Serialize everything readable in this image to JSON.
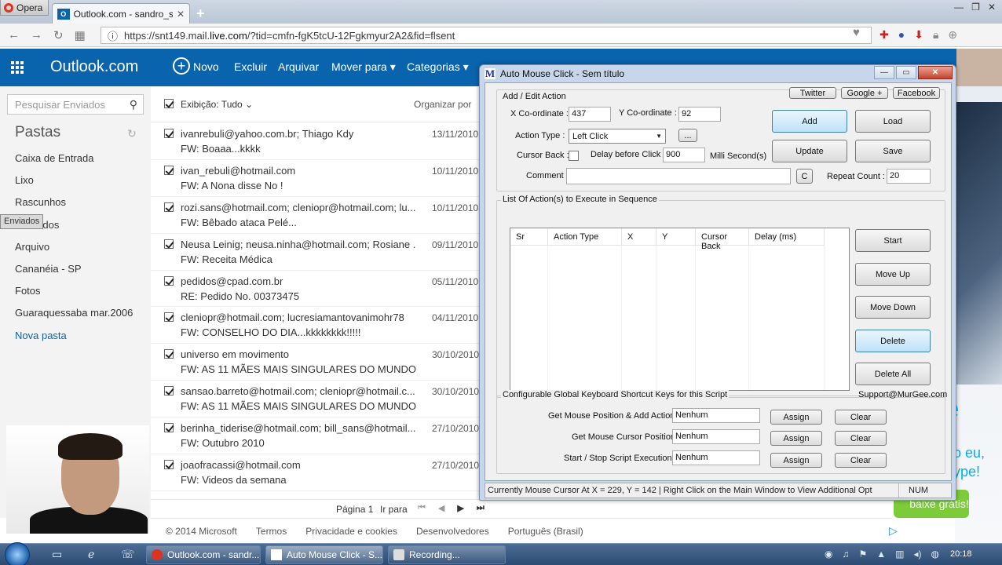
{
  "browser": {
    "opera_label": "Opera",
    "tab_title": "Outlook.com - sandro_ss",
    "tab_close": "✕",
    "new_tab": "+",
    "win_buttons": [
      "—",
      "❐",
      "✕"
    ],
    "url_prefix": "https://snt149.mail.",
    "url_host": "live.com",
    "url_rest": "/?tid=cmfn-fgK5tcU-12Fgkmyur2A2&fid=flsent"
  },
  "outlook": {
    "brand": "Outlook.com",
    "commands": {
      "novo": "Novo",
      "excluir": "Excluir",
      "arquivar": "Arquivar",
      "mover": "Mover para",
      "categorias": "Categorias"
    },
    "search_placeholder": "Pesquisar Enviados",
    "pastas_label": "Pastas",
    "folders": [
      {
        "label": "Caixa de Entrada"
      },
      {
        "label": "Lixo"
      },
      {
        "label": "Rascunhos"
      },
      {
        "label": "Enviados"
      },
      {
        "label": "Excluídos"
      },
      {
        "label": "Arquivo"
      },
      {
        "label": "Cananéia - SP"
      },
      {
        "label": "Fotos"
      },
      {
        "label": "Guaraquessaba mar.2006"
      },
      {
        "label": "Nova pasta"
      }
    ],
    "list_header": {
      "exibicao": "Exibição: Tudo",
      "organizar": "Organizar por"
    },
    "messages": [
      {
        "from": "ivanrebuli@yahoo.com.br; Thiago Kdy",
        "subject": "FW: Boaaa...kkkk",
        "date": "13/11/2010"
      },
      {
        "from": "ivan_rebuli@hotmail.com",
        "subject": "FW: A Nona disse No !",
        "date": "10/11/2010"
      },
      {
        "from": "rozi.sans@hotmail.com; cleniopr@hotmail.com; lu...",
        "subject": "FW: Bêbado ataca Pelé...",
        "date": "10/11/2010"
      },
      {
        "from": "Neusa Leinig; neusa.ninha@hotmail.com; Rosiane ...",
        "subject": "FW: Receita Médica",
        "date": "09/11/2010"
      },
      {
        "from": "pedidos@cpad.com.br",
        "subject": "RE: Pedido No. 00373475",
        "date": "05/11/2010"
      },
      {
        "from": "cleniopr@hotmail.com; lucresiamantovanimohr78",
        "subject": "FW: CONSELHO DO DIA...kkkkkkkk!!!!!",
        "date": "04/11/2010"
      },
      {
        "from": "universo em movimento",
        "subject": "FW: AS 11 MÃES MAIS SINGULARES DO MUNDO",
        "date": "30/10/2010"
      },
      {
        "from": "sansao.barreto@hotmail.com; cleniopr@hotmail.c...",
        "subject": "FW: AS 11 MÃES MAIS SINGULARES DO MUNDO",
        "date": "30/10/2010"
      },
      {
        "from": "berinha_tiderise@hotmail.com; bill_sans@hotmail...",
        "subject": "FW: Outubro 2010",
        "date": "27/10/2010"
      },
      {
        "from": "joaofracassi@hotmail.com",
        "subject": "FW: Videos da semana",
        "date": "27/10/2010"
      }
    ],
    "pager": {
      "page": "Página 1",
      "goto": "Ir para"
    },
    "footer": [
      "© 2014 Microsoft",
      "Termos",
      "Privacidade e cookies",
      "Desenvolvedores",
      "Português (Brasil)"
    ]
  },
  "ad": {
    "skype_text": "e",
    "line1": "o eu,",
    "line2": "ype!",
    "button": "baixe grátis!"
  },
  "amc": {
    "title": "Auto Mouse Click - Sem título",
    "logo": "M",
    "group_add_edit": "Add / Edit Action",
    "social": [
      "Twitter",
      "Google +",
      "Facebook"
    ],
    "x_label": "X Co-ordinate :",
    "x_value": "437",
    "y_label": "Y Co-ordinate :",
    "y_value": "92",
    "action_type_label": "Action Type :",
    "action_type_value": "Left Click",
    "ellipsis": "...",
    "cursor_back_label": "Cursor Back :",
    "delay_label": "Delay before Click :",
    "delay_value": "900",
    "delay_unit": "Milli Second(s)",
    "comment_label": "Comment :",
    "c_button": "C",
    "repeat_label": "Repeat Count :",
    "repeat_value": "20",
    "buttons": {
      "add": "Add",
      "load": "Load",
      "update": "Update",
      "save": "Save",
      "start": "Start",
      "move_up": "Move Up",
      "move_down": "Move Down",
      "delete": "Delete",
      "delete_all": "Delete All"
    },
    "list_title": "List Of Action(s) to Execute in Sequence",
    "columns": [
      "Sr",
      "Action Type",
      "X",
      "Y",
      "Cursor Back",
      "Delay (ms)"
    ],
    "shortcut_title": "Configurable Global Keyboard Shortcut Keys for this Script",
    "support": "Support@MurGee.com",
    "shortcuts": [
      {
        "label": "Get Mouse Position & Add Action :",
        "value": "Nenhum"
      },
      {
        "label": "Get Mouse Cursor Position :",
        "value": "Nenhum"
      },
      {
        "label": "Start / Stop Script Execution :",
        "value": "Nenhum"
      }
    ],
    "assign": "Assign",
    "clear": "Clear",
    "status": "Currently Mouse Cursor At X = 229, Y = 142 | Right Click on the Main Window to View Additional Opt",
    "num": "NUM"
  },
  "taskbar": {
    "items": [
      "Outlook.com - sandr...",
      "Auto Mouse Click - S...",
      "Recording..."
    ],
    "clock": "20:18"
  }
}
